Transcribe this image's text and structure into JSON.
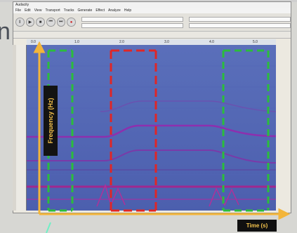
{
  "window": {
    "title": "Audacity"
  },
  "menus": [
    "File",
    "Edit",
    "View",
    "Transport",
    "Tracks",
    "Generate",
    "Effect",
    "Analyze",
    "Help"
  ],
  "toolbar": {
    "buttons": [
      "pause-icon",
      "play-icon",
      "stop-icon",
      "skip-start-icon",
      "skip-end-icon",
      "record-icon"
    ]
  },
  "ruler": {
    "ticks": [
      "0.0",
      "1.0",
      "2.0",
      "3.0",
      "4.0",
      "5.0"
    ]
  },
  "spectrogram": {
    "colormap": "blue-magenta"
  },
  "annotations": {
    "frequency_label": "Frequency (Hz)",
    "time_label": "Time (s)",
    "axis_color": "#f3b53a",
    "green_box_color": "#2bbd3c",
    "red_box_color": "#e02626",
    "arrow_color": "#6ff0c6"
  }
}
